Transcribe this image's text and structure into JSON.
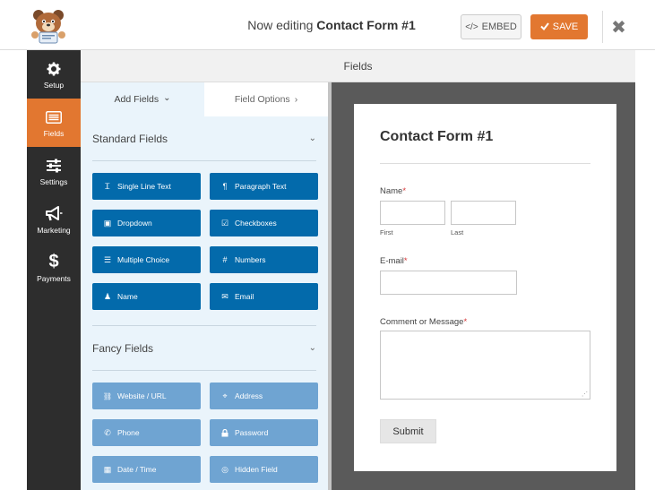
{
  "header": {
    "title_prefix": "Now editing",
    "form_name": "Contact Form #1",
    "embed_label": "EMBED",
    "save_label": "SAVE",
    "close_glyph": "✖"
  },
  "sidebar": {
    "items": [
      {
        "label": "Setup",
        "icon": "gear-icon",
        "active": false
      },
      {
        "label": "Fields",
        "icon": "list-icon",
        "active": true
      },
      {
        "label": "Settings",
        "icon": "sliders-icon",
        "active": false
      },
      {
        "label": "Marketing",
        "icon": "megaphone-icon",
        "active": false
      },
      {
        "label": "Payments",
        "icon": "dollar-icon",
        "active": false
      }
    ]
  },
  "fields_bar": {
    "title": "Fields"
  },
  "panel": {
    "tabs": [
      {
        "label": "Add Fields",
        "glyph": "⌄"
      },
      {
        "label": "Field Options",
        "glyph": "›"
      }
    ],
    "standard": {
      "title": "Standard Fields",
      "buttons": [
        {
          "label": "Single Line Text",
          "icon": "text-icon",
          "glyph": "Ꮖ"
        },
        {
          "label": "Paragraph Text",
          "icon": "paragraph-icon",
          "glyph": "¶"
        },
        {
          "label": "Dropdown",
          "icon": "dropdown-icon",
          "glyph": "▣"
        },
        {
          "label": "Checkboxes",
          "icon": "checkbox-icon",
          "glyph": "☑"
        },
        {
          "label": "Multiple Choice",
          "icon": "list-icon",
          "glyph": "☰"
        },
        {
          "label": "Numbers",
          "icon": "hash-icon",
          "glyph": "#"
        },
        {
          "label": "Name",
          "icon": "user-icon",
          "glyph": "♟"
        },
        {
          "label": "Email",
          "icon": "envelope-icon",
          "glyph": "✉"
        }
      ]
    },
    "fancy": {
      "title": "Fancy Fields",
      "buttons": [
        {
          "label": "Website / URL",
          "icon": "link-icon",
          "glyph": "🔗"
        },
        {
          "label": "Address",
          "icon": "map-marker-icon",
          "glyph": "⌖"
        },
        {
          "label": "Phone",
          "icon": "phone-icon",
          "glyph": "✆"
        },
        {
          "label": "Password",
          "icon": "lock-icon",
          "glyph": "🔒"
        },
        {
          "label": "Date / Time",
          "icon": "calendar-icon",
          "glyph": "▦"
        },
        {
          "label": "Hidden Field",
          "icon": "eye-slash-icon",
          "glyph": "◎"
        }
      ]
    }
  },
  "form": {
    "title": "Contact Form #1",
    "name_label": "Name",
    "first_label": "First",
    "last_label": "Last",
    "email_label": "E-mail",
    "comment_label": "Comment or Message",
    "required_mark": "*",
    "submit_label": "Submit"
  },
  "colors": {
    "accent": "#e27730",
    "field_button": "#036aab",
    "fancy_button": "#6fa4d2",
    "sidebar": "#2d2d2d",
    "panel_bg": "#eaf4fb",
    "preview_bg": "#5a5a5a"
  }
}
